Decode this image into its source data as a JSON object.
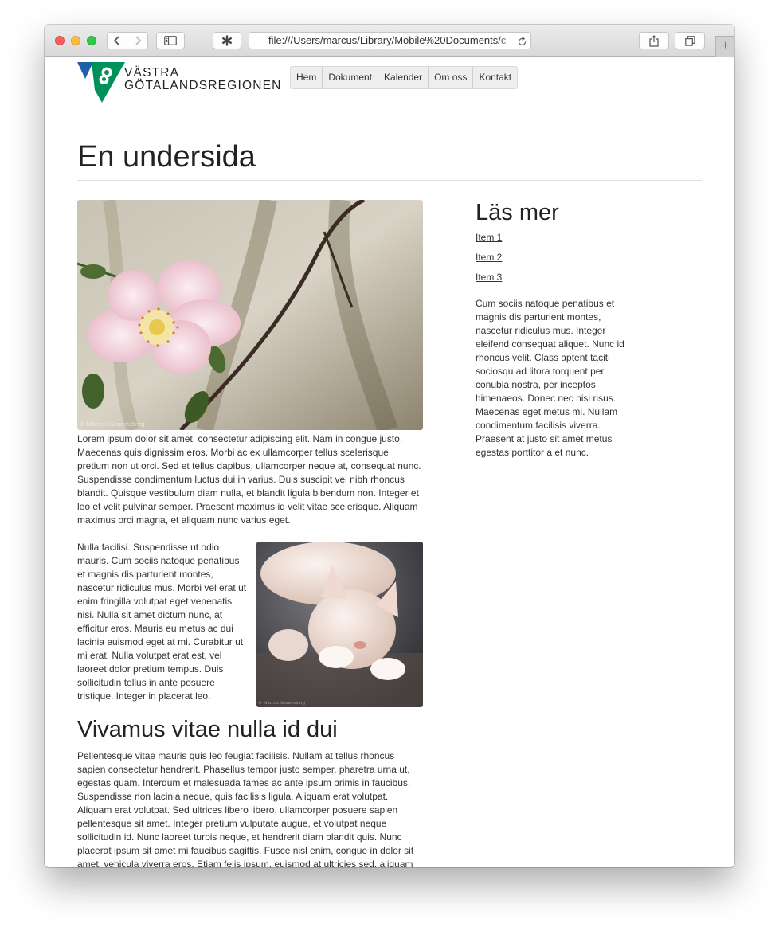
{
  "browser": {
    "address": "file:///Users/marcus/Library/Mobile%20Documents/c",
    "newtab_label": "+"
  },
  "site": {
    "logo_line1": "VÄSTRA",
    "logo_line2": "GÖTALANDSREGIONEN",
    "brand_colors": {
      "blue": "#1d5fa8",
      "green": "#00915a"
    },
    "nav": [
      "Hem",
      "Dokument",
      "Kalender",
      "Om oss",
      "Kontakt"
    ]
  },
  "page": {
    "title": "En undersida",
    "p1": "Lorem ipsum dolor sit amet, consectetur adipiscing elit. Nam in congue justo. Maecenas quis dignissim eros. Morbi ac ex ullamcorper tellus scelerisque pretium non ut orci. Sed et tellus dapibus, ullamcorper neque at, consequat nunc. Suspendisse condimentum luctus dui in varius. Duis suscipit vel nibh rhoncus blandit. Quisque vestibulum diam nulla, et blandit ligula bibendum non. Integer et leo et velit pulvinar semper. Praesent maximus id velit vitae scelerisque. Aliquam maximus orci magna, et aliquam nunc varius eget.",
    "p2": "Nulla facilisi. Suspendisse ut odio mauris. Cum sociis natoque penatibus et magnis dis parturient montes, nascetur ridiculus mus. Morbi vel erat ut enim fringilla volutpat eget venenatis nisi. Nulla sit amet dictum nunc, at efficitur eros. Mauris eu metus ac dui lacinia euismod eget at mi. Curabitur ut mi erat. Nulla volutpat erat est, vel laoreet dolor pretium tempus. Duis sollicitudin tellus in ante posuere tristique. Integer in placerat leo.",
    "h2": "Vivamus vitae nulla id dui",
    "p3": "Pellentesque vitae mauris quis leo feugiat facilisis. Nullam at tellus rhoncus sapien consectetur hendrerit. Phasellus tempor justo semper, pharetra urna ut, egestas quam. Interdum et malesuada fames ac ante ipsum primis in faucibus. Suspendisse non lacinia neque, quis facilisis ligula. Aliquam erat volutpat. Aliquam erat volutpat. Sed ultrices libero libero, ullamcorper posuere sapien pellentesque sit amet. Integer pretium vulputate augue, et volutpat neque sollicitudin id. Nunc laoreet turpis neque, et hendrerit diam blandit quis. Nunc placerat ipsum sit amet mi faucibus sagittis. Fusce nisl enim, congue in dolor sit amet, vehicula viverra eros. Etiam felis ipsum, euismod at ultricies sed, aliquam",
    "photo_credit": "© Marcus Gemeroberg"
  },
  "sidebar": {
    "title": "Läs mer",
    "links": [
      "Item 1",
      "Item 2",
      "Item 3"
    ],
    "text": "Cum sociis natoque penatibus et magnis dis parturient montes, nascetur ridiculus mus. Integer eleifend consequat aliquet. Nunc id rhoncus velit. Class aptent taciti sociosqu ad litora torquent per conubia nostra, per inceptos himenaeos. Donec nec nisi risus. Maecenas eget metus mi. Nullam condimentum facilisis viverra. Praesent at justo sit amet metus egestas porttitor a et nunc."
  }
}
